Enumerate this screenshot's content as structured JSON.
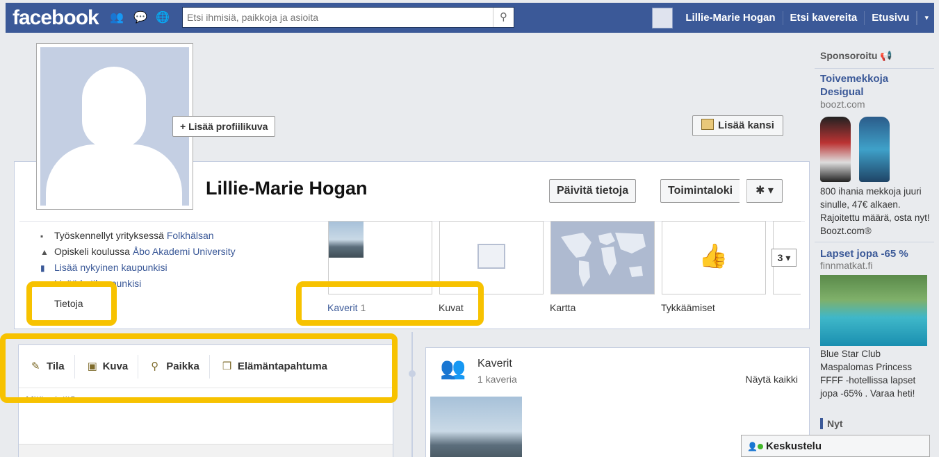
{
  "topbar": {
    "logo": "facebook",
    "search_placeholder": "Etsi ihmisiä, paikkoja ja asioita",
    "user_name": "Lillie-Marie Hogan",
    "find_friends": "Etsi kavereita",
    "home": "Etusivu",
    "caret": "▾"
  },
  "profile": {
    "add_profile_pic": "+ Lisää profiilikuva",
    "add_cover": "Lisää kansi",
    "name": "Lillie-Marie Hogan",
    "update_info": "Päivitä tietoja",
    "activity_log": "Toimintaloki",
    "gear": "✱ ▾",
    "info": {
      "work_prefix": "Työskennellyt yrityksessä ",
      "work_link": "Folkhälsan",
      "study_prefix": "Opiskeli koulussa ",
      "study_link": "Åbo Akademi University",
      "add_current_city": "Lisää nykyinen kaupunkisi",
      "add_hometown": "Lisää kotikaupunkisi"
    },
    "about_label": "Tietoja",
    "tiles": {
      "friends": "Kaverit",
      "friends_count": "1",
      "photos": "Kuvat",
      "map": "Kartta",
      "likes": "Tykkäämiset",
      "more": "3 ▾"
    }
  },
  "composer": {
    "tabs": [
      "Tila",
      "Kuva",
      "Paikka",
      "Elämäntapahtuma"
    ],
    "placeholder": "Mitä mietit?"
  },
  "friends_box": {
    "title": "Kaverit",
    "subtitle": "1 kaveria",
    "see_all": "Näytä kaikki"
  },
  "sidebar": {
    "sponsored": "Sponsoroitu",
    "ad1": {
      "title": "Toivemekkoja Desigual",
      "url": "boozt.com",
      "text": "800 ihania mekkoja juuri sinulle, 47€ alkaen. Rajoitettu määrä, osta nyt! Boozt.com®"
    },
    "ad2": {
      "title": "Lapset jopa -65 %",
      "url": "finnmatkat.fi",
      "text": "Blue Star Club Maspalomas Princess FFFF -hotellissa lapset jopa -65% . Varaa heti!"
    },
    "now": "Nyt"
  },
  "chat": {
    "label": "Keskustelu"
  },
  "colors": {
    "brand": "#3b5998",
    "highlight": "#f7c200"
  }
}
